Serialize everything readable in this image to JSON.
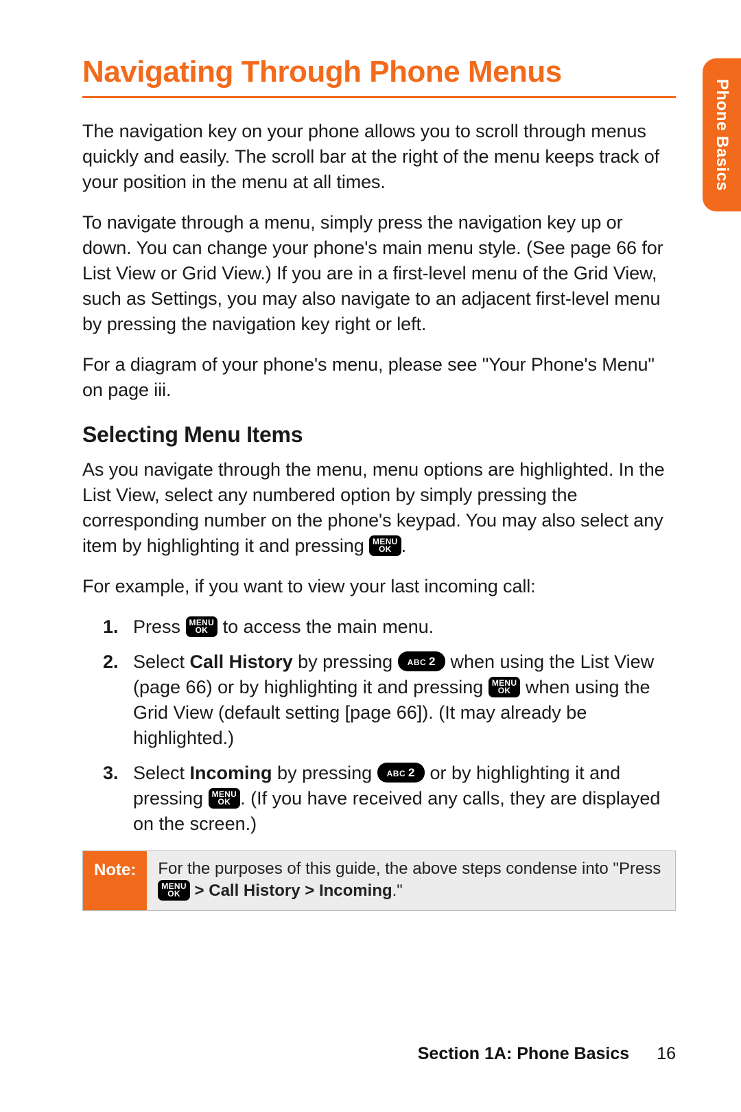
{
  "sideTab": "Phone Basics",
  "title": "Navigating Through Phone Menus",
  "p1": "The navigation key on your phone allows you to scroll through menus quickly and easily. The scroll bar at the right of the menu keeps track of your position in the menu at all times.",
  "p2": "To navigate through a menu, simply press the navigation key up or down. You can change your phone's main menu style. (See page 66 for List View or Grid View.) If you are in a first-level menu of the Grid View, such as Settings, you may also navigate to an adjacent first-level menu by pressing the navigation key right or left.",
  "p3": "For a diagram of your phone's menu, please see \"Your Phone's Menu\" on page iii.",
  "subhead": "Selecting Menu Items",
  "p4a": "As you navigate through the menu, menu options are highlighted. In the List View, select any numbered option by simply pressing the corresponding number on the phone's keypad. You may also select any item by highlighting it and pressing ",
  "p4b": ".",
  "p5": "For example, if you want to view your last incoming call:",
  "steps": {
    "s1": {
      "n": "1.",
      "a": "Press ",
      "b": " to access the main menu."
    },
    "s2": {
      "n": "2.",
      "a": "Select ",
      "bold1": "Call History",
      "b": " by pressing ",
      "c": " when using the List View (page 66) or by highlighting it and pressing ",
      "d": " when using the Grid View (default setting [page 66]). (It may already be highlighted.)"
    },
    "s3": {
      "n": "3.",
      "a": "Select ",
      "bold1": "Incoming",
      "b": " by pressing ",
      "c": " or by highlighting it and pressing ",
      "d": ". (If you have received any calls, they are displayed on the screen.)"
    }
  },
  "note": {
    "label": "Note:",
    "a": "For the purposes of this guide, the above steps condense into \"Press ",
    "b": " > ",
    "bold1": "Call History",
    "c": " > ",
    "bold2": "Incoming",
    "d": ".\""
  },
  "footer": {
    "section": "Section 1A: Phone Basics",
    "page": "16"
  }
}
